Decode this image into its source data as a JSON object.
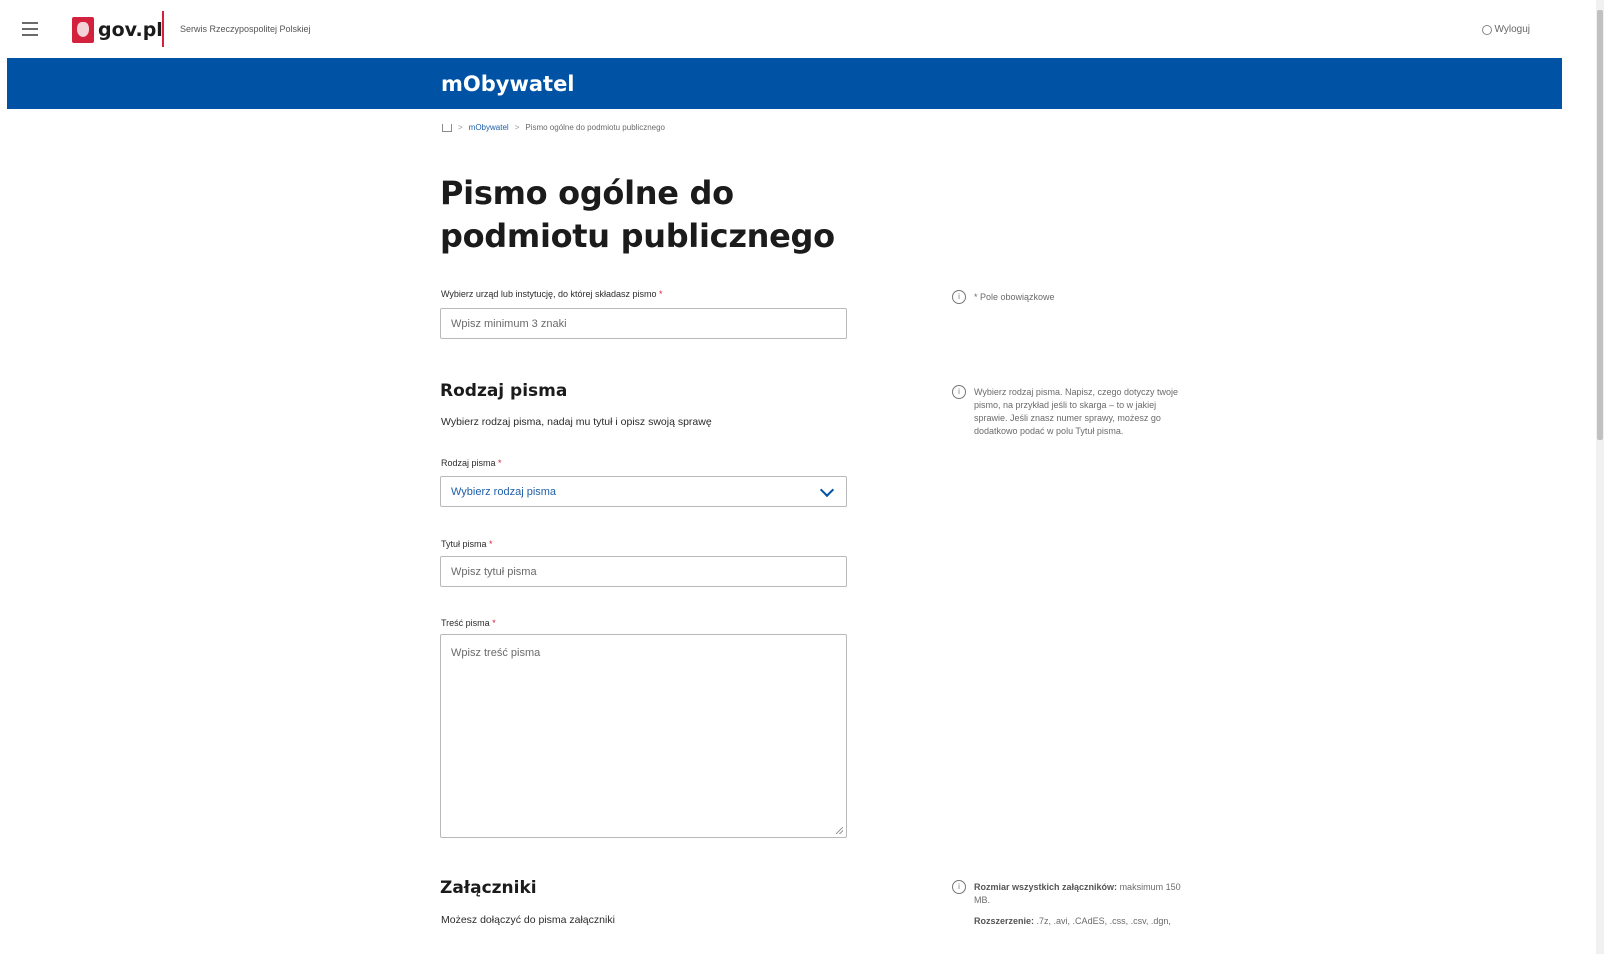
{
  "header": {
    "logo_text": "gov.pl",
    "service_name": "Serwis Rzeczypospolitej Polskiej",
    "logout_label": "Wyloguj"
  },
  "banner": {
    "title": "mObywatel"
  },
  "breadcrumb": {
    "items": [
      "mObywatel",
      "Pismo ogólne do podmiotu publicznego"
    ]
  },
  "page": {
    "title": "Pismo ogólne do podmiotu publicznego"
  },
  "institution": {
    "label": "Wybierz urząd lub instytucję, do której składasz pismo",
    "required_mark": "*",
    "placeholder": "Wpisz minimum 3 znaki",
    "info_text": "* Pole obowiązkowe"
  },
  "letter_type_section": {
    "title": "Rodzaj pisma",
    "description": "Wybierz rodzaj pisma, nadaj mu tytuł i opisz swoją sprawę",
    "info_text": "Wybierz rodzaj pisma. Napisz, czego dotyczy twoje pismo, na przykład jeśli to skarga – to w jakiej sprawie. Jeśli znasz numer sprawy, możesz go dodatkowo podać w polu Tytuł pisma.",
    "type_label": "Rodzaj pisma",
    "type_selected": "Wybierz rodzaj pisma",
    "title_label": "Tytuł pisma",
    "title_placeholder": "Wpisz tytuł pisma",
    "content_label": "Treść pisma",
    "content_placeholder": "Wpisz treść pisma",
    "required_mark": "*"
  },
  "attachments_section": {
    "title": "Załączniki",
    "description": "Możesz dołączyć do pisma załączniki",
    "info_bold": "Rozmiar wszystkich załączników:",
    "info_text": "maksimum 150 MB.",
    "ext_bold": "Rozszerzenie:",
    "ext_text": ".7z, .avi, .CAdES, .css, .csv, .dgn,"
  },
  "colors": {
    "brand_blue": "#0052a5",
    "brand_red": "#d4213d"
  }
}
